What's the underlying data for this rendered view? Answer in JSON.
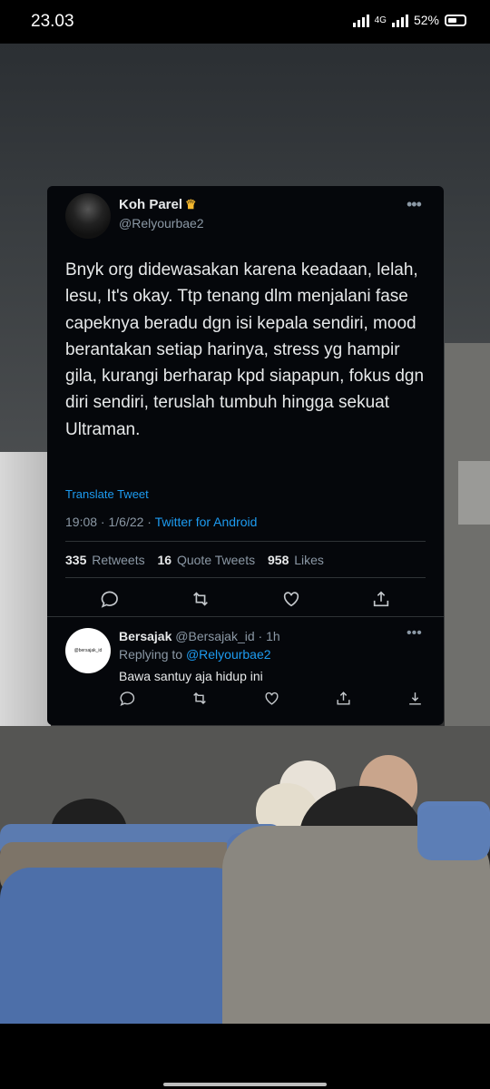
{
  "status_bar": {
    "time": "23.03",
    "network": "4G",
    "battery": "52%"
  },
  "tweet": {
    "author_name": "Koh Parel",
    "author_badge": "crown",
    "author_handle": "@Relyourbae2",
    "text": "Bnyk org didewasakan karena keadaan, lelah, lesu, It's okay. Ttp tenang dlm menjalani fase capeknya beradu dgn isi kepala sendiri, mood berantakan setiap harinya, stress yg hampir gila, kurangi berharap kpd siapapun, fokus dgn diri sendiri, teruslah tumbuh hingga sekuat Ultraman.",
    "translate_label": "Translate Tweet",
    "timestamp": "19:08 · 1/6/22 ·",
    "source_app": "Twitter for Android",
    "retweets_count": "335",
    "retweets_label": "Retweets",
    "quote_count": "16",
    "quote_label": "Quote Tweets",
    "likes_count": "958",
    "likes_label": "Likes"
  },
  "reply": {
    "author_name": "Bersajak",
    "author_handle": "@Bersajak_id",
    "age": "· 1h",
    "avatar_text": "@bersajak_id",
    "replying_prefix": "Replying to",
    "replying_to": "@Relyourbae2",
    "text": "Bawa santuy aja hidup ini"
  },
  "icons": [
    "more-icon",
    "reply-icon",
    "retweet-icon",
    "like-icon",
    "share-icon",
    "download-icon",
    "crown-icon"
  ],
  "colors": {
    "link": "#1d9bf0",
    "card_bg": "#05070b",
    "muted": "#8b98a5",
    "text": "#e7e9ea"
  }
}
